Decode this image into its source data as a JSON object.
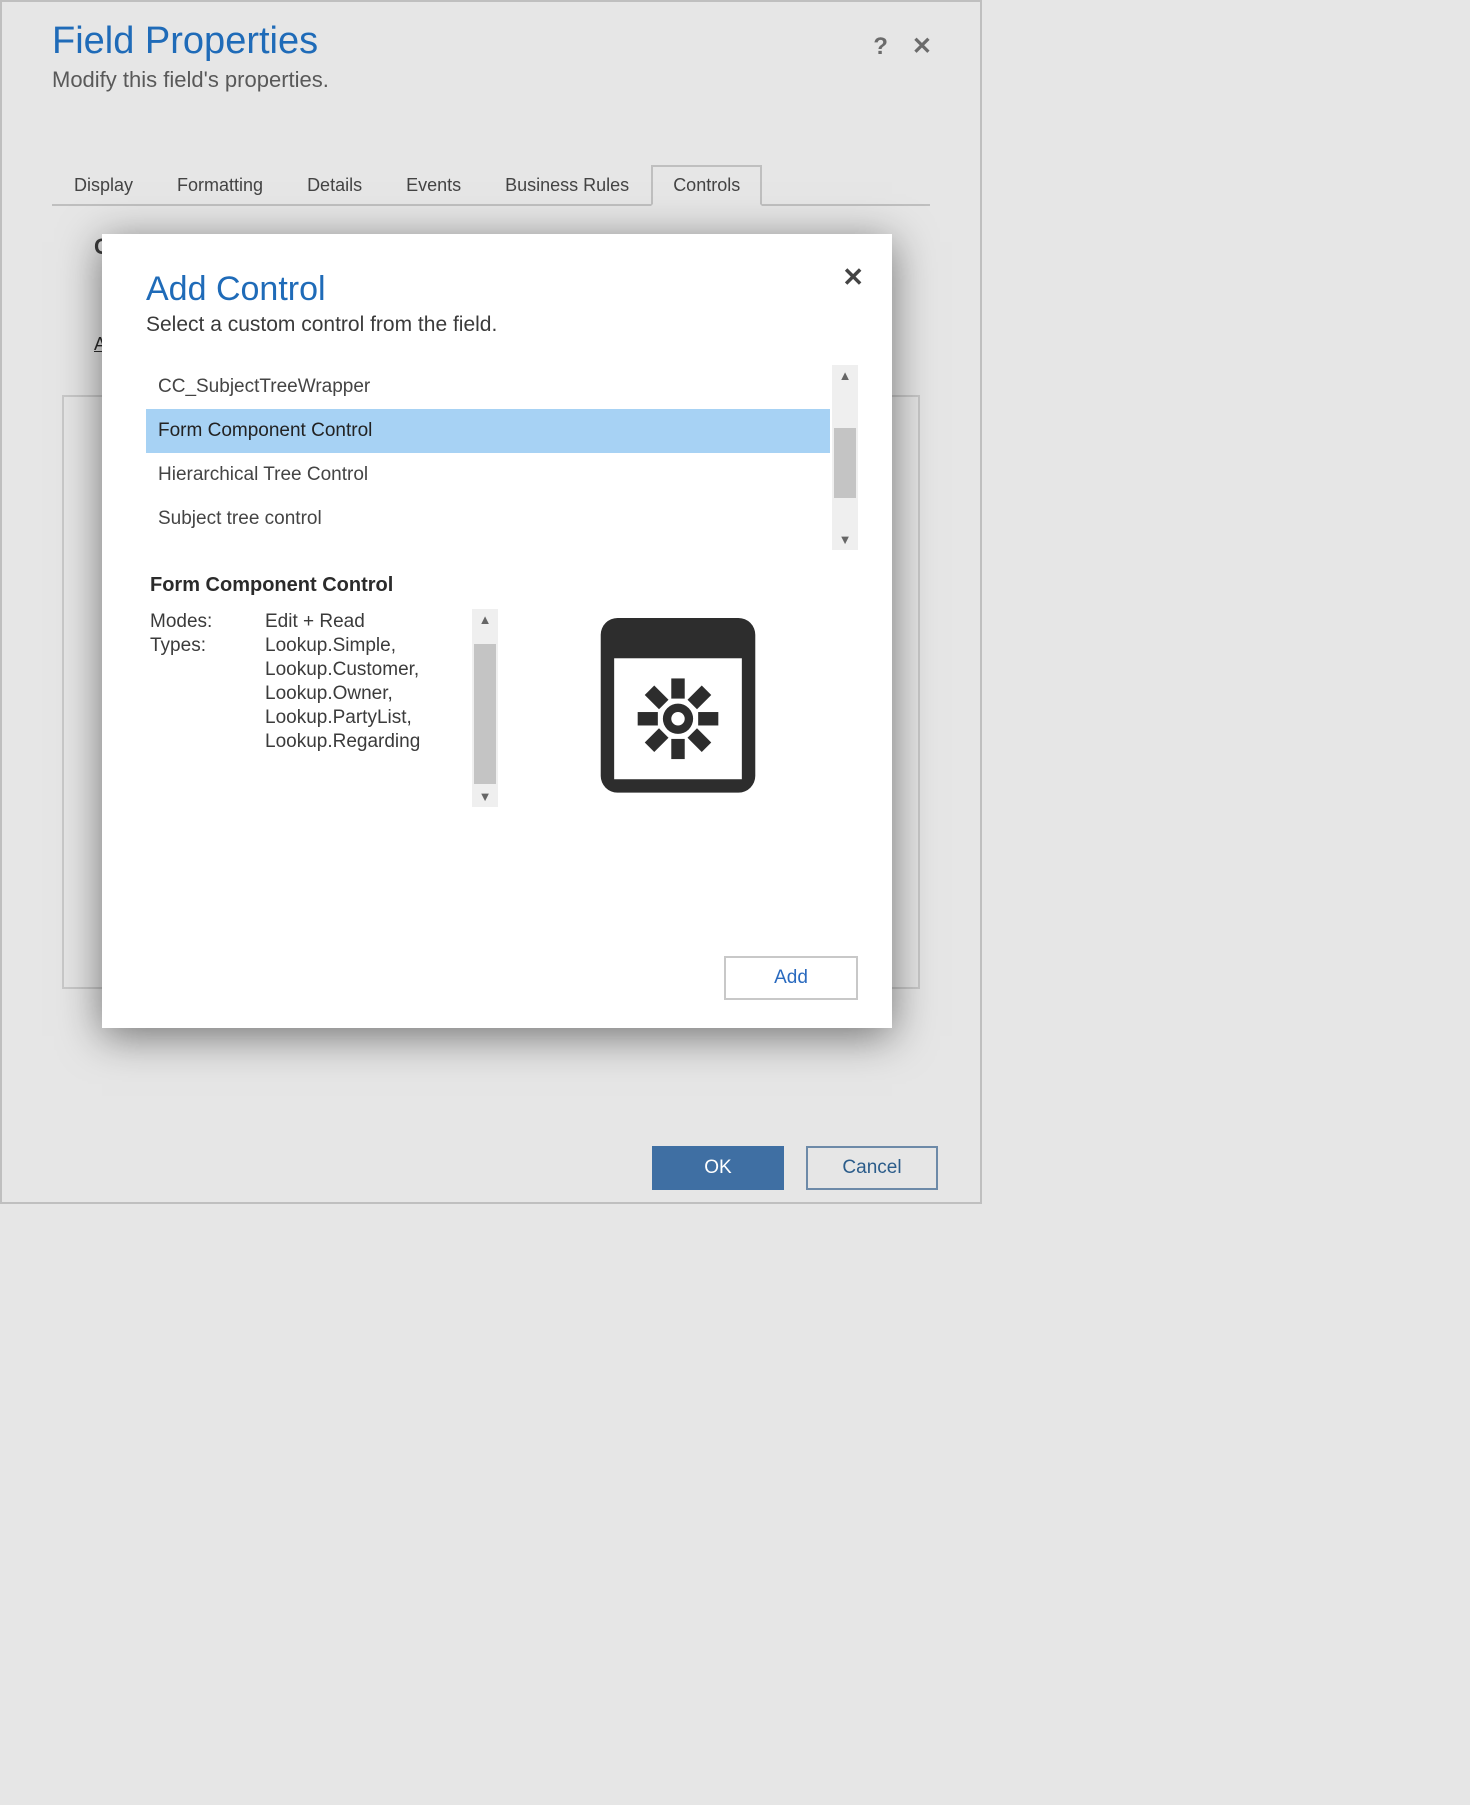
{
  "background_dialog": {
    "title": "Field Properties",
    "subtitle": "Modify this field's properties.",
    "tabs": [
      "Display",
      "Formatting",
      "Details",
      "Events",
      "Business Rules",
      "Controls"
    ],
    "active_tab_index": 5,
    "panel_heading_partial": "C",
    "panel_link_partial": "A",
    "ok_label": "OK",
    "cancel_label": "Cancel"
  },
  "modal": {
    "title": "Add Control",
    "subtitle": "Select a custom control from the field.",
    "controls": [
      "CC_SubjectTreeWrapper",
      "Form Component Control",
      "Hierarchical Tree Control",
      "Subject tree control"
    ],
    "selected_index": 1,
    "selected": {
      "name": "Form Component Control",
      "modes_label": "Modes:",
      "modes_value": "Edit + Read",
      "types_label": "Types:",
      "types_values": [
        "Lookup.Simple,",
        "Lookup.Customer,",
        "Lookup.Owner,",
        "Lookup.PartyList,",
        "Lookup.Regarding"
      ]
    },
    "add_label": "Add"
  }
}
